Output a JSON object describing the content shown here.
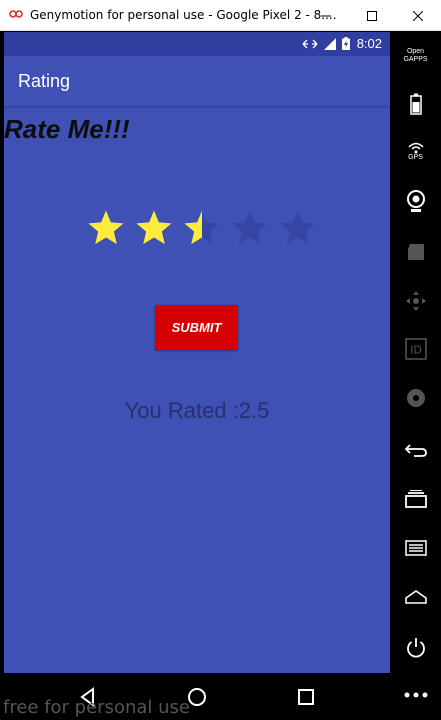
{
  "window": {
    "title": "Genymotion for personal use - Google Pixel 2 - 8....",
    "minimize_icon": "minimize-icon",
    "maximize_icon": "maximize-icon",
    "close_icon": "close-icon"
  },
  "status_bar": {
    "time": "8:02",
    "icons": [
      "data-arrows-icon",
      "signal-icon",
      "battery-charging-icon"
    ]
  },
  "app_bar": {
    "title": "Rating"
  },
  "main": {
    "heading": "Rate Me!!!",
    "rating": {
      "value": 2.5,
      "max": 5,
      "filled_color": "#ffeb3b",
      "empty_color": "#3546a6"
    },
    "submit_label": "SUBMIT",
    "result_text": "You Rated :2.5"
  },
  "nav_bar": {
    "buttons": [
      "back-icon",
      "home-icon",
      "recents-icon"
    ]
  },
  "sidebar": {
    "opengapps_label": "Open GAPPS",
    "gps_label": "GPS",
    "items": [
      "opengapps-icon",
      "battery-icon",
      "gps-icon",
      "webcam-icon",
      "media-icon",
      "dpad-icon",
      "id-icon",
      "disk-icon",
      "back-icon",
      "recents-icon",
      "menu-icon",
      "home-icon",
      "power-icon",
      "more-icon"
    ]
  },
  "watermark": "free for personal use",
  "colors": {
    "primary": "#3f51b5",
    "primary_dark": "#303f9f",
    "accent": "#d50000"
  }
}
